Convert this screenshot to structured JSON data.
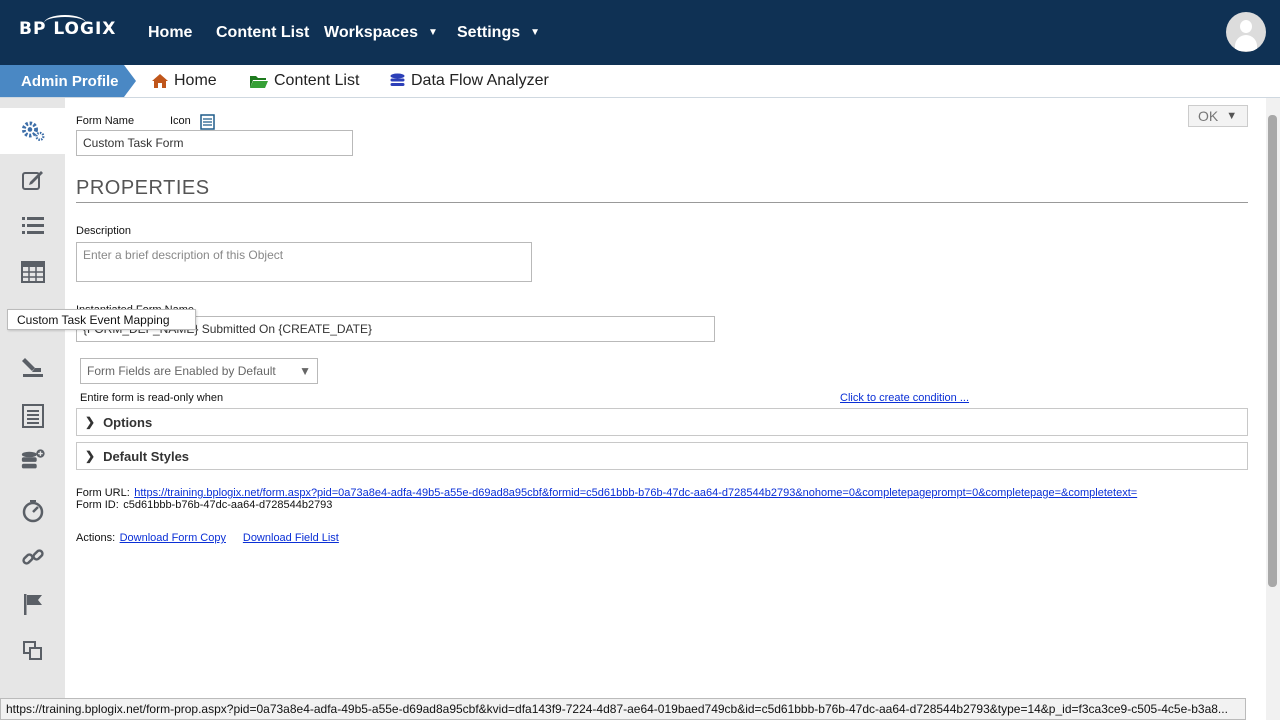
{
  "topbar": {
    "logo_text": "BP LOGIX",
    "nav": [
      {
        "label": "Home"
      },
      {
        "label": "Content List"
      },
      {
        "label": "Workspaces"
      },
      {
        "label": "Settings"
      }
    ],
    "avatar": "user-avatar-icon"
  },
  "secbar": {
    "admin_label": "Admin Profile",
    "items": [
      {
        "label": "Home",
        "icon": "home-icon",
        "color": "#c0561b"
      },
      {
        "label": "Content List",
        "icon": "folder-icon",
        "color": "#2a8a2a"
      },
      {
        "label": "Data Flow Analyzer",
        "icon": "database-icon",
        "color": "#2c3fb8"
      }
    ]
  },
  "sidebar": {
    "tooltip": "Custom Task Event Mapping"
  },
  "form": {
    "name_label": "Form Name",
    "icon_label": "Icon",
    "name_value": "Custom Task Form",
    "properties_heading": "PROPERTIES",
    "description_label": "Description",
    "description_placeholder": "Enter a brief description of this Object",
    "instantiated_label": "Instantiated Form Name",
    "instantiated_value": "{FORM_DEF_NAME} Submitted On {CREATE_DATE}",
    "fields_select": "Form Fields are Enabled by Default",
    "readonly_label": "Entire form is read-only when",
    "condition_link": "Click to create condition ...",
    "options_label": "Options",
    "default_styles_label": "Default Styles",
    "url_label": "Form URL:",
    "url_value": "https://training.bplogix.net/form.aspx?pid=0a73a8e4-adfa-49b5-a55e-d69ad8a95cbf&formid=c5d61bbb-b76b-47dc-aa64-d728544b2793&nohome=0&completepageprompt=0&completepage=&completetext=",
    "id_label": "Form ID:",
    "id_value": "c5d61bbb-b76b-47dc-aa64-d728544b2793",
    "actions_label": "Actions:",
    "download_copy": "Download Form Copy",
    "download_fields": "Download Field List",
    "ok_label": "OK"
  },
  "statusbar": {
    "url": "https://training.bplogix.net/form-prop.aspx?pid=0a73a8e4-adfa-49b5-a55e-d69ad8a95cbf&kvid=dfa143f9-7224-4d87-ae64-019baed749cb&id=c5d61bbb-b76b-47dc-aa64-d728544b2793&type=14&p_id=f3ca3ce9-c505-4c5e-b3a8..."
  }
}
